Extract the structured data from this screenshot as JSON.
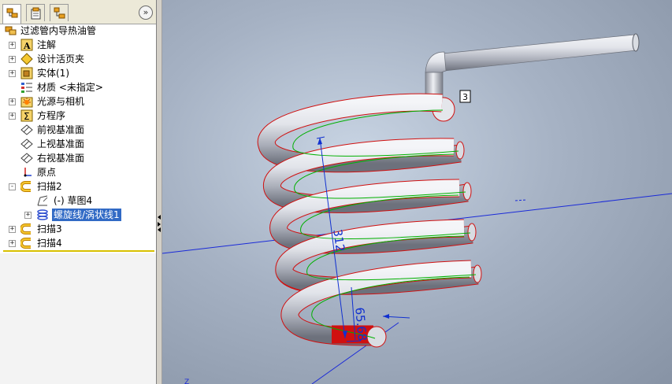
{
  "tree": {
    "root": "过滤管内导热油管",
    "items": [
      {
        "label": "注解",
        "icon": "annotations-icon",
        "expander": "+"
      },
      {
        "label": "设计活页夹",
        "icon": "design-binder-icon",
        "expander": "+"
      },
      {
        "label": "实体(1)",
        "icon": "solid-bodies-icon",
        "expander": "+"
      },
      {
        "label": "材质 <未指定>",
        "icon": "material-icon",
        "expander": ""
      },
      {
        "label": "光源与相机",
        "icon": "lights-cameras-icon",
        "expander": "+"
      },
      {
        "label": "方程序",
        "icon": "equations-icon",
        "expander": "+"
      },
      {
        "label": "前视基准面",
        "icon": "plane-icon",
        "expander": ""
      },
      {
        "label": "上视基准面",
        "icon": "plane-icon",
        "expander": ""
      },
      {
        "label": "右视基准面",
        "icon": "plane-icon",
        "expander": ""
      },
      {
        "label": "原点",
        "icon": "origin-icon",
        "expander": ""
      },
      {
        "label": "扫描2",
        "icon": "sweep-icon",
        "expander": "-"
      },
      {
        "label": "(-) 草图4",
        "icon": "sketch-icon",
        "expander": ""
      },
      {
        "label": "螺旋线/涡状线1",
        "icon": "helix-icon",
        "expander": "+"
      },
      {
        "label": "扫描3",
        "icon": "sweep-icon",
        "expander": "+"
      },
      {
        "label": "扫描4",
        "icon": "sweep-icon",
        "expander": "+"
      }
    ]
  },
  "tabs": {
    "collapse": "»"
  },
  "viewport": {
    "dimension_height": "312",
    "dimension_pitch": "65.68",
    "callout": "3",
    "axis_label": "Z",
    "colors": {
      "tube": "#c9ccd3",
      "edge": "#e01010",
      "path": "#00b000",
      "dimension": "#1030d0"
    }
  }
}
